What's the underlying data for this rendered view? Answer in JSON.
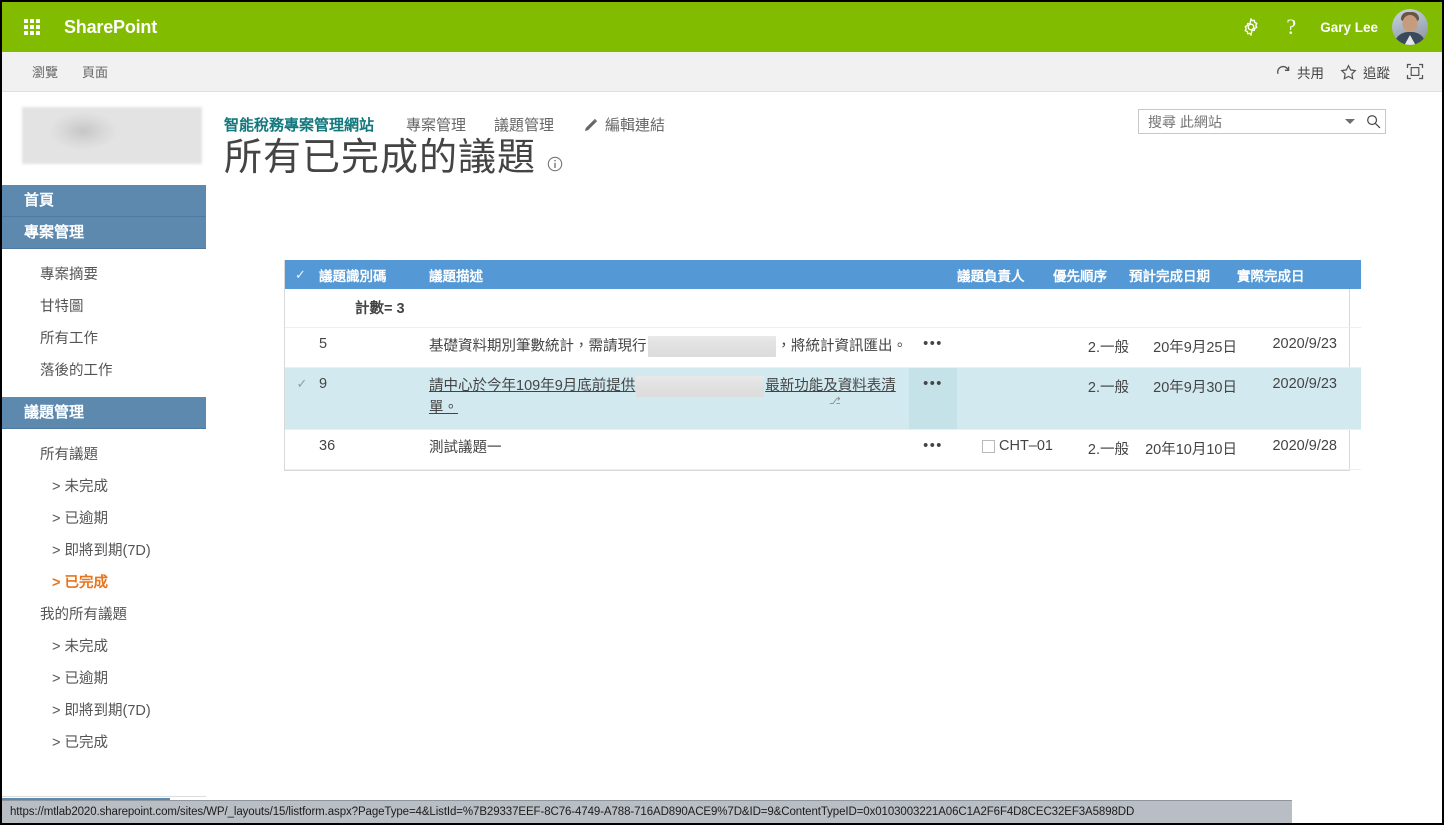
{
  "suite": {
    "waffle_icon": "waffle-grid-icon",
    "brand": "SharePoint",
    "settings_icon": "gear-icon",
    "help_icon": "question-mark-icon",
    "help_label": "?",
    "user_name": "Gary Lee",
    "avatar_icon": "user-avatar"
  },
  "ribbon": {
    "tabs": [
      {
        "label": "瀏覽"
      },
      {
        "label": "頁面"
      }
    ],
    "actions": [
      {
        "label": "共用",
        "icon": "share-icon"
      },
      {
        "label": "追蹤",
        "icon": "star-icon"
      },
      {
        "label": "",
        "icon": "focus-on-content-icon"
      }
    ]
  },
  "left": {
    "logo_icon": "site-logo-image",
    "nav": [
      {
        "label": "首頁",
        "type": "header",
        "active": false
      },
      {
        "label": "專案管理",
        "type": "header",
        "active": false
      },
      {
        "label": "專案摘要",
        "type": "item",
        "active": false
      },
      {
        "label": "甘特圖",
        "type": "item",
        "active": false
      },
      {
        "label": "所有工作",
        "type": "item",
        "active": false
      },
      {
        "label": "落後的工作",
        "type": "item",
        "active": false
      },
      {
        "label": "議題管理",
        "type": "header",
        "active": false
      },
      {
        "label": "所有議題",
        "type": "item",
        "active": false
      },
      {
        "label": "> 未完成",
        "type": "subitem",
        "active": false
      },
      {
        "label": "> 已逾期",
        "type": "subitem",
        "active": false
      },
      {
        "label": "> 即將到期(7D)",
        "type": "subitem",
        "active": false
      },
      {
        "label": "> 已完成",
        "type": "subitem",
        "active": true
      },
      {
        "label": "我的所有議題",
        "type": "item",
        "active": false
      },
      {
        "label": "> 未完成",
        "type": "subitem",
        "active": false
      },
      {
        "label": "> 已逾期",
        "type": "subitem",
        "active": false
      },
      {
        "label": "> 即將到期(7D)",
        "type": "subitem",
        "active": false
      },
      {
        "label": "> 已完成",
        "type": "subitem",
        "active": false
      }
    ]
  },
  "topnav": {
    "site_title": "智能稅務專案管理網站",
    "links": [
      {
        "label": "專案管理"
      },
      {
        "label": "議題管理"
      }
    ],
    "edit_links_label": "編輯連結",
    "edit_icon": "pencil-icon"
  },
  "page": {
    "title": "所有已完成的議題",
    "info_icon": "info-circle-icon"
  },
  "search": {
    "value": "搜尋 此網站",
    "placeholder": "搜尋 此網站",
    "caret_icon": "chevron-down-icon",
    "search_icon": "search-icon"
  },
  "list": {
    "select_all_icon": "check-icon",
    "columns": [
      {
        "key": "id",
        "label": "議題識別碼"
      },
      {
        "key": "desc",
        "label": "議題描述"
      },
      {
        "key": "menu",
        "label": ""
      },
      {
        "key": "owner",
        "label": "議題負責人"
      },
      {
        "key": "prio",
        "label": "優先順序"
      },
      {
        "key": "due",
        "label": "預計完成日期"
      },
      {
        "key": "act",
        "label": "實際完成日"
      }
    ],
    "count_label": "計數= 3",
    "menu_glyph": "•••",
    "rows": [
      {
        "selected": false,
        "id": "5",
        "desc_part1": "基礎資料期別筆數統計，需請現行",
        "desc_redacted": true,
        "desc_part2": "，將統計資訊匯出。",
        "owner": "",
        "owner_checkbox": false,
        "priority": "2.一般",
        "due_date": "20年9月25日",
        "actual_date": "2020/9/23"
      },
      {
        "selected": true,
        "id": "9",
        "desc_part1": "請中心於今年109年9月底前提供",
        "desc_redacted": true,
        "desc_part2": "最新功能及資料表清單。",
        "owner": "",
        "owner_checkbox": false,
        "priority": "2.一般",
        "due_date": "20年9月30日",
        "actual_date": "2020/9/23"
      },
      {
        "selected": false,
        "id": "36",
        "desc_part1": "測試議題一",
        "desc_redacted": false,
        "desc_part2": "",
        "owner": "CHT–01",
        "owner_checkbox": true,
        "priority": "2.一般",
        "due_date": "20年10月10日",
        "actual_date": "2020/9/28"
      }
    ]
  },
  "statusbar": {
    "url": "https://mtlab2020.sharepoint.com/sites/WP/_layouts/15/listform.aspx?PageType=4&ListId=%7B29337EEF-8C76-4749-A788-716AD890ACE9%7D&ID=9&ContentTypeID=0x0103003221A06C1A2F6F4D8CEC32EF3A5898DD"
  },
  "colors": {
    "suite_green": "#81bc00",
    "nav_header_blue": "#5d89ae",
    "table_header_blue": "#5499d6",
    "selected_row": "#d2e9ef",
    "accent_orange": "#e8741e",
    "link_teal": "#13787d",
    "id_teal": "#1a8a8f"
  }
}
